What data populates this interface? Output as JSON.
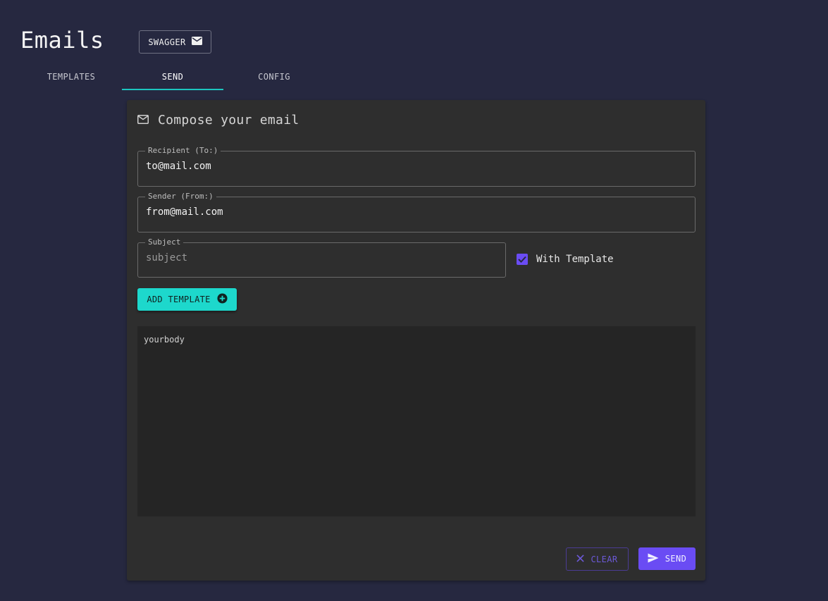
{
  "page": {
    "title": "Emails"
  },
  "header": {
    "swagger_label": "SWAGGER"
  },
  "tabs": [
    {
      "label": "TEMPLATES",
      "active": false
    },
    {
      "label": "SEND",
      "active": true
    },
    {
      "label": "CONFIG",
      "active": false
    }
  ],
  "compose": {
    "title": "Compose your email",
    "recipient": {
      "label": "Recipient (To:)",
      "value": "to@mail.com"
    },
    "sender": {
      "label": "Sender (From:)",
      "value": "from@mail.com"
    },
    "subject": {
      "label": "Subject",
      "placeholder": "subject",
      "value": ""
    },
    "with_template": {
      "label": "With Template",
      "checked": true
    },
    "add_template_label": "ADD TEMPLATE",
    "body": "yourbody",
    "clear_label": "CLEAR",
    "send_label": "SEND"
  },
  "colors": {
    "background": "#262840",
    "card": "#2e2e2e",
    "accent_teal": "#1dd8cc",
    "accent_purple": "#6a4cf4"
  }
}
